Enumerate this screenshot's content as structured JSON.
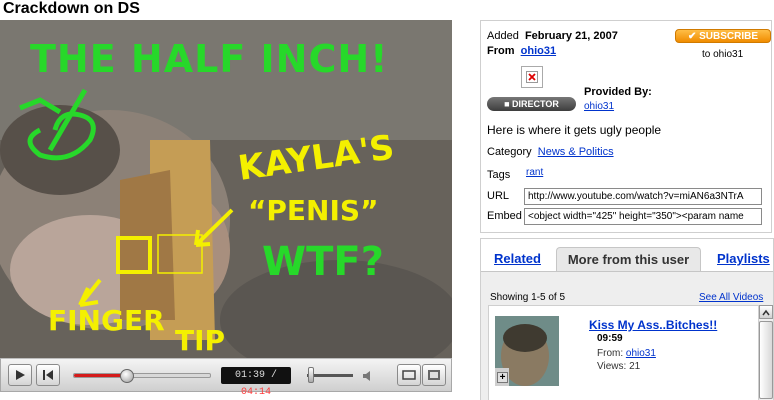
{
  "page": {
    "title": "Crackdown on DS"
  },
  "player": {
    "current_time": "01:39",
    "separator": " / ",
    "total_time": "04:14",
    "progress_fraction": 0.39,
    "overlay_text": {
      "top": "THE HALF INCH!",
      "right1": "KAYLA'S",
      "right2": "“PENIS”",
      "right3": "WTF?",
      "bottom1": "FINGER",
      "bottom2": "TIP"
    }
  },
  "info": {
    "added_label": "Added",
    "added_date": "February 21, 2007",
    "from_label": "From",
    "from_user": "ohio31",
    "subscribe_label": "SUBSCRIBE",
    "subscribe_to": "to ohio31",
    "director_badge": "DIRECTOR",
    "provided_by_label": "Provided By:",
    "provided_by_user": "ohio31",
    "description": "Here is where it gets ugly people",
    "category_label": "Category",
    "category_value": "News & Politics",
    "tags_label": "Tags",
    "tags_value": "rant",
    "url_label": "URL",
    "url_value": "http://www.youtube.com/watch?v=miAN6a3NTrA",
    "embed_label": "Embed",
    "embed_value": "<object width=\"425\" height=\"350\"><param name"
  },
  "tabs": {
    "related": "Related",
    "more_from_user": "More from this user",
    "playlists": "Playlists",
    "showing": "Showing 1-5 of 5",
    "see_all": "See All Videos"
  },
  "videos": [
    {
      "title": "Kiss My Ass..Bitches!!",
      "duration": "09:59",
      "from_label": "From:",
      "from_user": "ohio31",
      "views_label": "Views:",
      "views": "21"
    }
  ],
  "colors": {
    "accent_link": "#0033cc",
    "progress": "#d41b1b",
    "subscribe": "#f08c00",
    "overlay_green": "#27d82a",
    "overlay_yellow": "#f4f000"
  }
}
